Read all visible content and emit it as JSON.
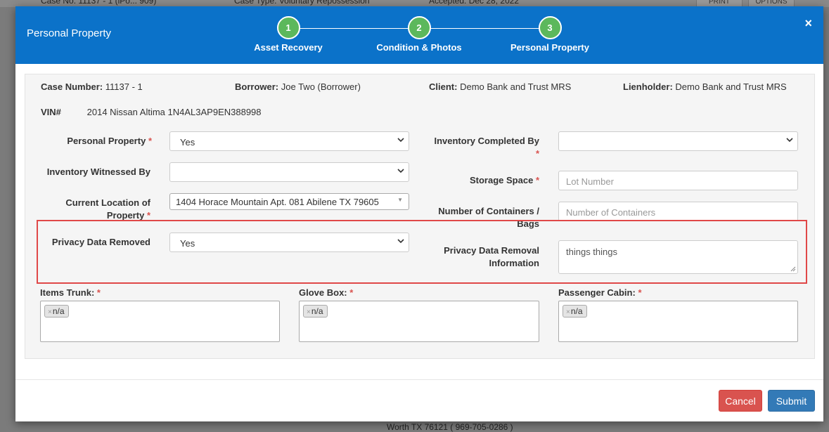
{
  "background": {
    "case_no": "Case No: 11137 - 1 (iPo... 909)",
    "case_type": "Case Type: Voluntary Repossession",
    "accepted": "Accepted: Dec 28, 2022",
    "print": "PRINT",
    "options": "OPTIONS",
    "bottom_text": "Worth TX 76121 ( 969-705-0286 )"
  },
  "modal": {
    "title": "Personal Property",
    "close": "×",
    "steps": [
      {
        "number": "1",
        "label": "Asset Recovery"
      },
      {
        "number": "2",
        "label": "Condition & Photos"
      },
      {
        "number": "3",
        "label": "Personal Property"
      }
    ]
  },
  "info": {
    "case_number_label": "Case Number:",
    "case_number": "11137 - 1",
    "borrower_label": "Borrower:",
    "borrower": "Joe Two (Borrower)",
    "client_label": "Client:",
    "client": "Demo Bank and Trust MRS",
    "lienholder_label": "Lienholder:",
    "lienholder": "Demo Bank and Trust MRS",
    "vin_label": "VIN#",
    "vin": "2014 Nissan Altima 1N4AL3AP9EN388998"
  },
  "form": {
    "required_mark": "*",
    "personal_property_label": "Personal Property",
    "personal_property_value": "Yes",
    "inventory_witnessed_label": "Inventory Witnessed By",
    "inventory_witnessed_value": "",
    "current_location_label_1": "Current Location of",
    "current_location_label_2": "Property",
    "current_location_value": "1404 Horace Mountain Apt. 081 Abilene TX 79605",
    "privacy_removed_label": "Privacy Data Removed",
    "privacy_removed_value": "Yes",
    "inventory_completed_label": "Inventory Completed By",
    "inventory_completed_value": "",
    "storage_space_label": "Storage Space",
    "storage_space_placeholder": "Lot Number",
    "containers_label_1": "Number of Containers /",
    "containers_label_2": "Bags",
    "containers_placeholder": "Number of Containers",
    "privacy_info_label_1": "Privacy Data Removal",
    "privacy_info_label_2": "Information",
    "privacy_info_value": "things things",
    "items_trunk_label": "Items Trunk:",
    "items_trunk_tag": "n/a",
    "glove_box_label": "Glove Box:",
    "glove_box_tag": "n/a",
    "passenger_cabin_label": "Passenger Cabin:",
    "passenger_cabin_tag": "n/a",
    "tag_remove": "×"
  },
  "footer": {
    "cancel": "Cancel",
    "submit": "Submit"
  },
  "colors": {
    "header": "#0b72c9",
    "step": "#5cb85c",
    "cancel": "#d9534f",
    "submit": "#337ab7",
    "highlight": "#e04848"
  }
}
